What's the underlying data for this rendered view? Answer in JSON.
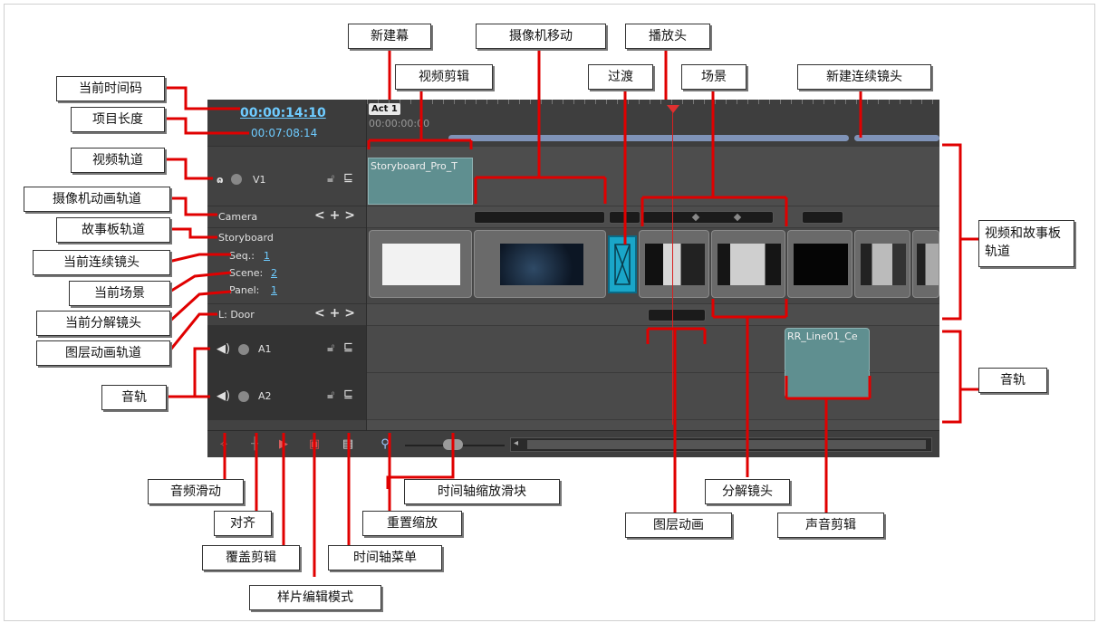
{
  "timeline": {
    "current_timecode": "00:00:14:10",
    "project_length": "00:07:08:14",
    "act_label": "Act 1",
    "ruler_time": "00:00:00:00",
    "v1_label": "V1",
    "camera_label": "Camera",
    "camera_nav": "< + >",
    "storyboard_label": "Storyboard",
    "seq_label": "Seq.:",
    "seq_value": "1",
    "scene_label": "Scene:",
    "scene_value": "2",
    "panel_label": "Panel:",
    "panel_value": "1",
    "layer_label": "L: Door",
    "layer_nav": "< + >",
    "a1_label": "A1",
    "a2_label": "A2",
    "video_clip_name": "Storyboard_Pro_T",
    "sound_clip_name": "RR_Line01_Ce"
  },
  "callouts": {
    "current_timecode": "当前时间码",
    "project_length": "项目长度",
    "video_track": "视频轨道",
    "camera_track": "摄像机动画轨道",
    "storyboard_track": "故事板轨道",
    "current_sequence": "当前连续镜头",
    "current_scene": "当前场景",
    "current_panel": "当前分解镜头",
    "layer_track": "图层动画轨道",
    "audio_tracks": "音轨",
    "new_act": "新建幕",
    "video_clip": "视频剪辑",
    "camera_move": "摄像机移动",
    "transition": "过渡",
    "playhead": "播放头",
    "scene": "场景",
    "new_sequence": "新建连续镜头",
    "video_storyboard_tracks": "视频和故事板轨道",
    "audio_track_right": "音轨",
    "audio_scrub": "音频滑动",
    "snap": "对齐",
    "overwrite_clips": "覆盖剪辑",
    "sample_edit_mode": "样片编辑模式",
    "timeline_menu": "时间轴菜单",
    "reset_zoom": "重置缩放",
    "zoom_slider": "时间轴缩放滑块",
    "layer_animation": "图层动画",
    "panel": "分解镜头",
    "sound_clip": "声音剪辑"
  },
  "colors": {
    "callout_line": "#e00000",
    "timecode": "#6ecbff",
    "transition": "#1aa6c8",
    "video_clip": "#5f8f90"
  }
}
